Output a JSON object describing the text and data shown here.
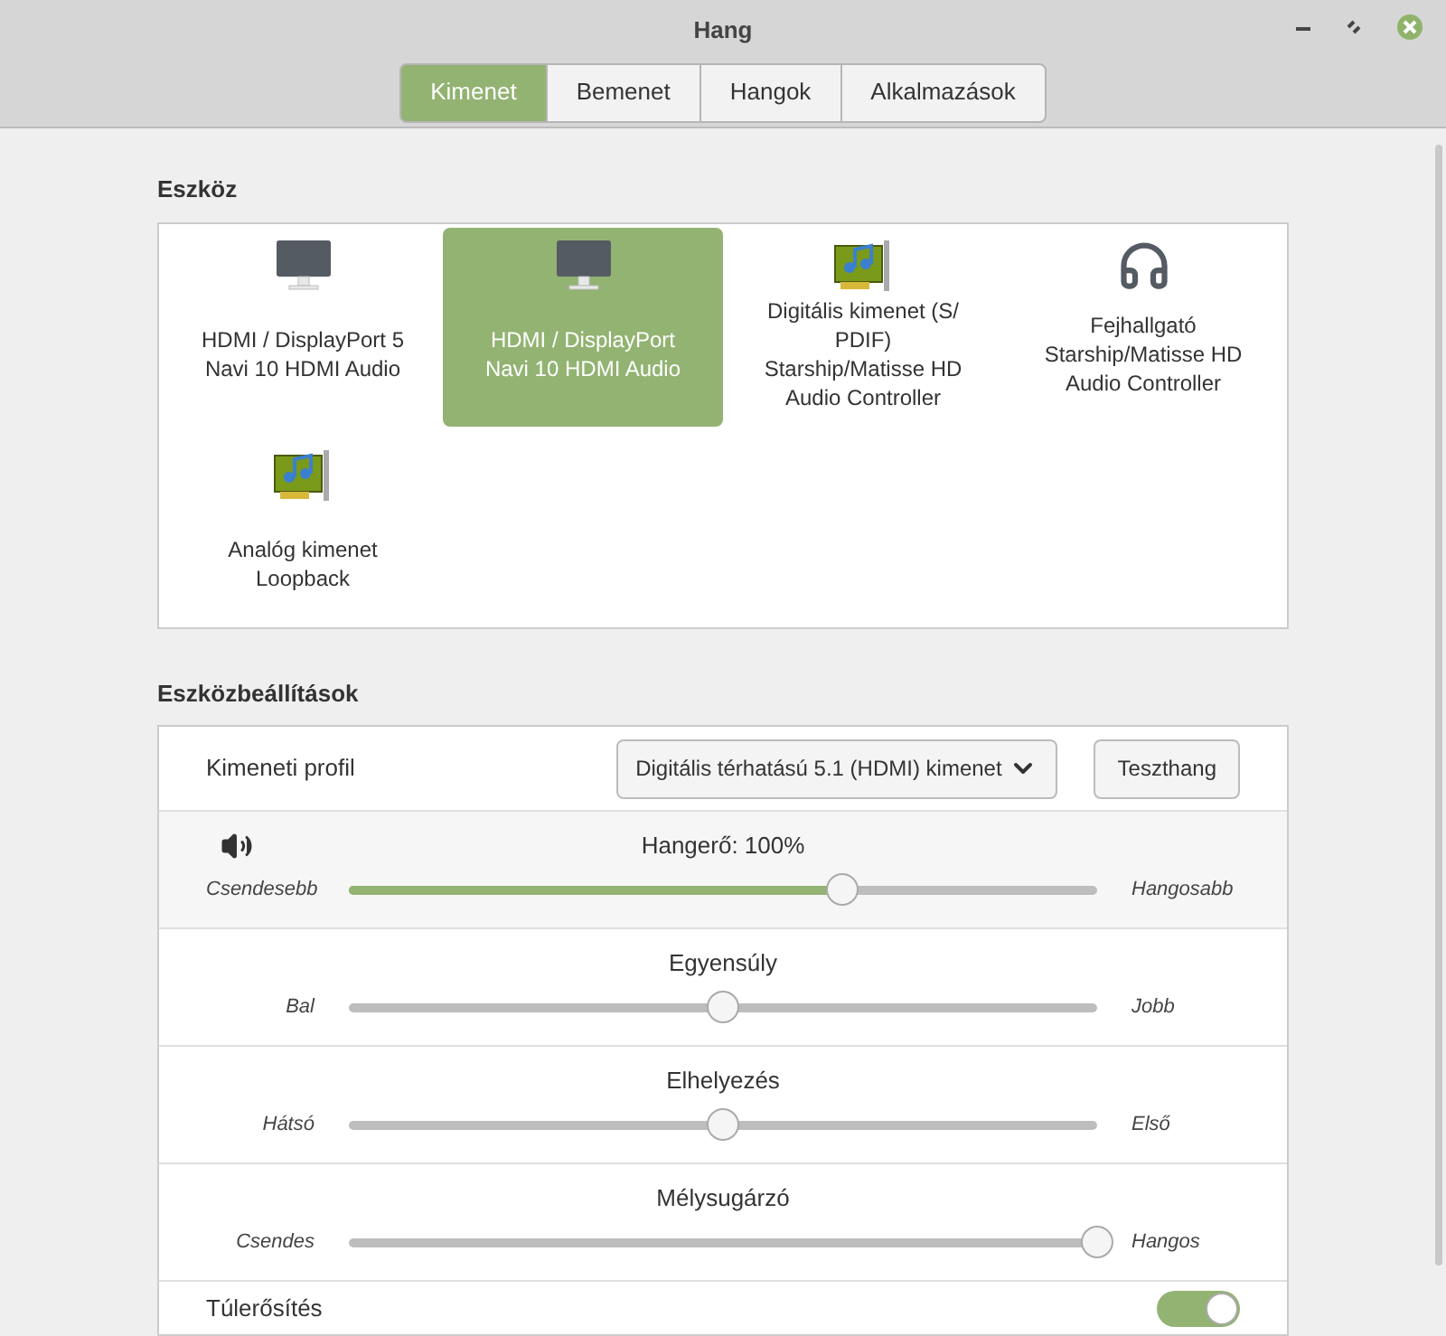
{
  "window": {
    "title": "Hang"
  },
  "tabs": [
    {
      "label": "Kimenet",
      "selected": true
    },
    {
      "label": "Bemenet",
      "selected": false
    },
    {
      "label": "Hangok",
      "selected": false
    },
    {
      "label": "Alkalmazások",
      "selected": false
    }
  ],
  "devices_section": {
    "title": "Eszköz",
    "devices": [
      {
        "kind": "monitor",
        "lines": [
          "HDMI / DisplayPort 5",
          "Navi 10 HDMI Audio"
        ],
        "selected": false
      },
      {
        "kind": "monitor",
        "lines": [
          "HDMI / DisplayPort",
          "Navi 10 HDMI Audio"
        ],
        "selected": true
      },
      {
        "kind": "card",
        "lines": [
          "Digitális kimenet (S/",
          "PDIF)",
          "Starship/Matisse HD",
          "Audio Controller"
        ],
        "selected": false
      },
      {
        "kind": "headphones",
        "lines": [
          "Fejhallgató",
          "Starship/Matisse HD",
          "Audio Controller"
        ],
        "selected": false
      },
      {
        "kind": "card",
        "lines": [
          "Analóg kimenet",
          "Loopback"
        ],
        "selected": false
      }
    ]
  },
  "settings": {
    "title": "Eszközbeállítások",
    "profile_label": "Kimeneti profil",
    "profile_value": "Digitális térhatású 5.1 (HDMI) kimenet",
    "test_button": "Teszthang",
    "sliders": [
      {
        "kind": "volume",
        "label": "Hangerő: 100%",
        "min_label": "Csendesebb",
        "max_label": "Hangosabb",
        "level": 0.66
      },
      {
        "kind": "plain",
        "label": "Egyensúly",
        "min_label": "Bal",
        "max_label": "Jobb",
        "level": 0.5
      },
      {
        "kind": "plain",
        "label": "Elhelyezés",
        "min_label": "Hátsó",
        "max_label": "Első",
        "level": 0.5
      },
      {
        "kind": "plain",
        "label": "Mélysugárzó",
        "min_label": "Csendes",
        "max_label": "Hangos",
        "level": 1
      }
    ],
    "boost": {
      "label": "Túlerősítés",
      "on": true
    }
  }
}
